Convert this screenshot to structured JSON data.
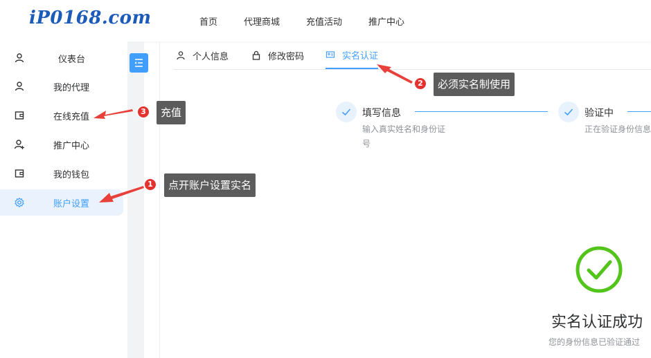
{
  "header": {
    "logo_text": "iP0168.com",
    "nav": [
      "首页",
      "代理商城",
      "充值活动",
      "推广中心"
    ]
  },
  "sidebar": {
    "items": [
      {
        "label": "仪表台",
        "icon": "user-icon"
      },
      {
        "label": "我的代理",
        "icon": "user-icon"
      },
      {
        "label": "在线充值",
        "icon": "wallet-icon"
      },
      {
        "label": "推广中心",
        "icon": "user-plus-icon"
      },
      {
        "label": "我的钱包",
        "icon": "wallet-icon"
      },
      {
        "label": "账户设置",
        "icon": "gear-icon",
        "active": true
      }
    ]
  },
  "tabs": [
    {
      "label": "个人信息",
      "icon": "user-icon"
    },
    {
      "label": "修改密码",
      "icon": "lock-icon"
    },
    {
      "label": "实名认证",
      "icon": "id-card-icon",
      "active": true
    }
  ],
  "steps": [
    {
      "title": "填写信息",
      "desc_line1": "输入真实姓名和身份证",
      "desc_line2": "号"
    },
    {
      "title": "验证中",
      "desc_line1": "正在验证身份信息"
    }
  ],
  "result": {
    "title": "实名认证成功",
    "subtitle": "您的身份信息已验证通过"
  },
  "annotations": [
    {
      "number": "1",
      "text": "点开账户设置实名"
    },
    {
      "number": "2",
      "text": "必须实名制使用"
    },
    {
      "number": "3",
      "text": "充值"
    }
  ],
  "colors": {
    "accent": "#409eff",
    "success": "#52c41a",
    "annotation_bg": "#5c5c5c",
    "badge_red": "#e4322f",
    "arrow_red": "#e8403a"
  }
}
